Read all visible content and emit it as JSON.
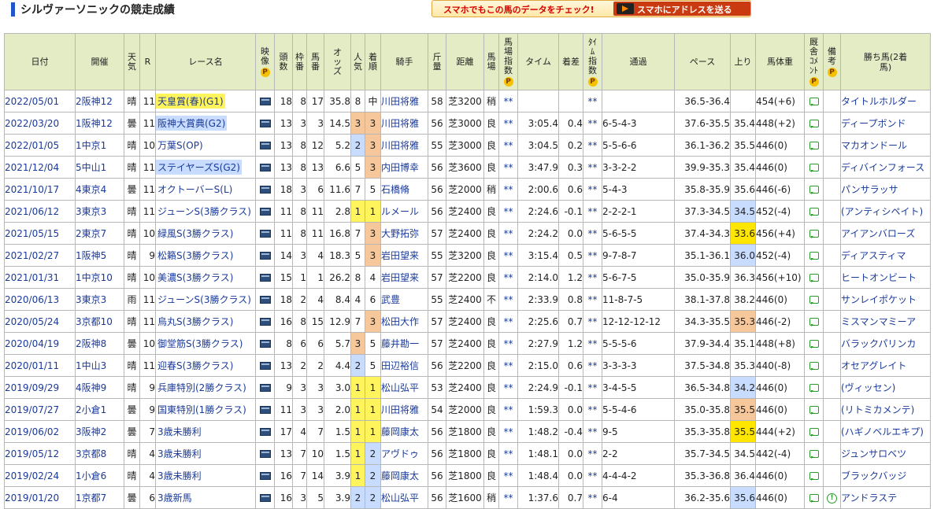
{
  "title": "シルヴァーソニックの競走成績",
  "banner": {
    "text": "スマホでもこの馬のデータをチェック!",
    "button_label": "スマホにアドレスを送る"
  },
  "headers": [
    "日付",
    "開催",
    "天気",
    "R",
    "レース名",
    "映像",
    "頭数",
    "枠番",
    "馬番",
    "オッズ",
    "人気",
    "着順",
    "騎手",
    "斤量",
    "距離",
    "馬場",
    "馬場指数",
    "タイム",
    "着差",
    "ﾀｲﾑ指数",
    "通過",
    "ペース",
    "上り",
    "馬体重",
    "厩舎ｺﾒﾝﾄ",
    "備考",
    "勝ち馬(2着馬)"
  ],
  "colors": {
    "header_bg": "#e4ecc6",
    "link": "#1a3a9a",
    "rank1": "#fff45c",
    "rank2": "#c8dcff",
    "rank3": "#f6c79a",
    "premium_badge": "#f5c000"
  },
  "rows": [
    {
      "date": "2022/05/01",
      "venue": "2阪神12",
      "weather": "晴",
      "r": "11",
      "race": "天皇賞(春)(G1)",
      "race_hl": "yellow",
      "heads": "18",
      "waku": "8",
      "umaban": "17",
      "odds": "35.8",
      "pop": "8",
      "pop_hl": "",
      "rank": "中",
      "rank_hl": "",
      "jockey": "川田将雅",
      "weight": "58",
      "dist": "芝3200",
      "baba": "稍",
      "baba_idx": "**",
      "time": "",
      "margin": "",
      "time_idx": "**",
      "pass": "",
      "pace": "36.5-36.4",
      "last3": "",
      "last3_hl": "",
      "body": "454(+6)",
      "note": false,
      "winner": "タイトルホルダー"
    },
    {
      "date": "2022/03/20",
      "venue": "1阪神12",
      "weather": "曇",
      "r": "11",
      "race": "阪神大賞典(G2)",
      "race_hl": "blue",
      "heads": "13",
      "waku": "3",
      "umaban": "3",
      "odds": "14.5",
      "pop": "3",
      "pop_hl": "3",
      "rank": "3",
      "rank_hl": "3",
      "jockey": "川田将雅",
      "weight": "56",
      "dist": "芝3000",
      "baba": "良",
      "baba_idx": "**",
      "time": "3:05.4",
      "margin": "0.4",
      "time_idx": "**",
      "pass": "6-5-4-3",
      "pace": "37.6-35.5",
      "last3": "35.4",
      "last3_hl": "",
      "body": "448(+2)",
      "note": false,
      "winner": "ディープボンド"
    },
    {
      "date": "2022/01/05",
      "venue": "1中京1",
      "weather": "晴",
      "r": "10",
      "race": "万葉S(OP)",
      "race_hl": "",
      "heads": "13",
      "waku": "8",
      "umaban": "12",
      "odds": "5.2",
      "pop": "2",
      "pop_hl": "2",
      "rank": "3",
      "rank_hl": "3",
      "jockey": "川田将雅",
      "weight": "55",
      "dist": "芝3000",
      "baba": "良",
      "baba_idx": "**",
      "time": "3:04.5",
      "margin": "0.2",
      "time_idx": "**",
      "pass": "5-5-6-6",
      "pace": "36.1-36.2",
      "last3": "35.5",
      "last3_hl": "",
      "body": "446(0)",
      "note": false,
      "winner": "マカオンドール"
    },
    {
      "date": "2021/12/04",
      "venue": "5中山1",
      "weather": "晴",
      "r": "11",
      "race": "ステイヤーズS(G2)",
      "race_hl": "blue",
      "heads": "13",
      "waku": "8",
      "umaban": "13",
      "odds": "6.6",
      "pop": "5",
      "pop_hl": "",
      "rank": "3",
      "rank_hl": "3",
      "jockey": "内田博幸",
      "weight": "56",
      "dist": "芝3600",
      "baba": "良",
      "baba_idx": "**",
      "time": "3:47.9",
      "margin": "0.3",
      "time_idx": "**",
      "pass": "3-3-2-2",
      "pace": "39.9-35.3",
      "last3": "35.4",
      "last3_hl": "",
      "body": "446(0)",
      "note": false,
      "winner": "ディバインフォース"
    },
    {
      "date": "2021/10/17",
      "venue": "4東京4",
      "weather": "曇",
      "r": "11",
      "race": "オクトーバーS(L)",
      "race_hl": "",
      "heads": "18",
      "waku": "3",
      "umaban": "6",
      "odds": "11.6",
      "pop": "7",
      "pop_hl": "",
      "rank": "5",
      "rank_hl": "",
      "jockey": "石橋脩",
      "weight": "56",
      "dist": "芝2000",
      "baba": "稍",
      "baba_idx": "**",
      "time": "2:00.6",
      "margin": "0.6",
      "time_idx": "**",
      "pass": "5-4-3",
      "pace": "35.8-35.9",
      "last3": "35.6",
      "last3_hl": "",
      "body": "446(-6)",
      "note": false,
      "winner": "パンサラッサ"
    },
    {
      "date": "2021/06/12",
      "venue": "3東京3",
      "weather": "晴",
      "r": "11",
      "race": "ジューンS(3勝クラス)",
      "race_hl": "",
      "heads": "11",
      "waku": "8",
      "umaban": "11",
      "odds": "2.8",
      "pop": "1",
      "pop_hl": "1",
      "rank": "1",
      "rank_hl": "1",
      "jockey": "ルメール",
      "weight": "56",
      "dist": "芝2400",
      "baba": "良",
      "baba_idx": "**",
      "time": "2:24.6",
      "margin": "-0.1",
      "time_idx": "**",
      "pass": "2-2-2-1",
      "pace": "37.3-34.5",
      "last3": "34.5",
      "last3_hl": "2",
      "body": "452(-4)",
      "note": false,
      "winner": "(アンティシペイト)"
    },
    {
      "date": "2021/05/15",
      "venue": "2東京7",
      "weather": "晴",
      "r": "10",
      "race": "緑風S(3勝クラス)",
      "race_hl": "",
      "heads": "11",
      "waku": "8",
      "umaban": "11",
      "odds": "16.8",
      "pop": "7",
      "pop_hl": "",
      "rank": "3",
      "rank_hl": "3",
      "jockey": "大野拓弥",
      "weight": "57",
      "dist": "芝2400",
      "baba": "良",
      "baba_idx": "**",
      "time": "2:24.2",
      "margin": "0.0",
      "time_idx": "**",
      "pass": "5-6-5-5",
      "pace": "37.4-34.3",
      "last3": "33.6",
      "last3_hl": "1",
      "body": "456(+4)",
      "note": false,
      "winner": "アイアンバローズ"
    },
    {
      "date": "2021/02/27",
      "venue": "1阪神5",
      "weather": "晴",
      "r": "9",
      "race": "松籟S(3勝クラス)",
      "race_hl": "",
      "heads": "14",
      "waku": "3",
      "umaban": "4",
      "odds": "18.3",
      "pop": "5",
      "pop_hl": "",
      "rank": "3",
      "rank_hl": "3",
      "jockey": "岩田望来",
      "weight": "55",
      "dist": "芝3200",
      "baba": "良",
      "baba_idx": "**",
      "time": "3:15.4",
      "margin": "0.5",
      "time_idx": "**",
      "pass": "9-7-8-7",
      "pace": "35.1-36.1",
      "last3": "36.0",
      "last3_hl": "2",
      "body": "452(-4)",
      "note": false,
      "winner": "ディアスティマ"
    },
    {
      "date": "2021/01/31",
      "venue": "1中京10",
      "weather": "晴",
      "r": "10",
      "race": "美濃S(3勝クラス)",
      "race_hl": "",
      "heads": "15",
      "waku": "1",
      "umaban": "1",
      "odds": "26.2",
      "pop": "8",
      "pop_hl": "",
      "rank": "4",
      "rank_hl": "",
      "jockey": "岩田望来",
      "weight": "57",
      "dist": "芝2200",
      "baba": "良",
      "baba_idx": "**",
      "time": "2:14.0",
      "margin": "1.2",
      "time_idx": "**",
      "pass": "5-6-7-5",
      "pace": "35.0-35.9",
      "last3": "36.3",
      "last3_hl": "",
      "body": "456(+10)",
      "note": false,
      "winner": "ヒートオンビート"
    },
    {
      "date": "2020/06/13",
      "venue": "3東京3",
      "weather": "雨",
      "r": "11",
      "race": "ジューンS(3勝クラス)",
      "race_hl": "",
      "heads": "18",
      "waku": "2",
      "umaban": "4",
      "odds": "8.4",
      "pop": "4",
      "pop_hl": "",
      "rank": "6",
      "rank_hl": "",
      "jockey": "武豊",
      "weight": "55",
      "dist": "芝2400",
      "baba": "不",
      "baba_idx": "**",
      "time": "2:33.9",
      "margin": "0.8",
      "time_idx": "**",
      "pass": "11-8-7-5",
      "pace": "38.1-37.8",
      "last3": "38.2",
      "last3_hl": "",
      "body": "446(0)",
      "note": false,
      "winner": "サンレイポケット"
    },
    {
      "date": "2020/05/24",
      "venue": "3京都10",
      "weather": "晴",
      "r": "11",
      "race": "烏丸S(3勝クラス)",
      "race_hl": "",
      "heads": "16",
      "waku": "8",
      "umaban": "15",
      "odds": "12.9",
      "pop": "7",
      "pop_hl": "",
      "rank": "3",
      "rank_hl": "3",
      "jockey": "松田大作",
      "weight": "57",
      "dist": "芝2400",
      "baba": "良",
      "baba_idx": "**",
      "time": "2:25.6",
      "margin": "0.7",
      "time_idx": "**",
      "pass": "12-12-12-12",
      "pace": "34.3-35.5",
      "last3": "35.3",
      "last3_hl": "3",
      "body": "446(-2)",
      "note": false,
      "winner": "ミスマンマミーア"
    },
    {
      "date": "2020/04/19",
      "venue": "2阪神8",
      "weather": "曇",
      "r": "10",
      "race": "御堂筋S(3勝クラス)",
      "race_hl": "",
      "heads": "8",
      "waku": "6",
      "umaban": "6",
      "odds": "5.7",
      "pop": "3",
      "pop_hl": "3",
      "rank": "5",
      "rank_hl": "",
      "jockey": "藤井勘一",
      "weight": "57",
      "dist": "芝2400",
      "baba": "良",
      "baba_idx": "**",
      "time": "2:27.9",
      "margin": "1.2",
      "time_idx": "**",
      "pass": "5-5-5-6",
      "pace": "37.9-34.4",
      "last3": "35.1",
      "last3_hl": "",
      "body": "448(+8)",
      "note": false,
      "winner": "バラックパリンカ"
    },
    {
      "date": "2020/01/11",
      "venue": "1中山3",
      "weather": "晴",
      "r": "11",
      "race": "迎春S(3勝クラス)",
      "race_hl": "",
      "heads": "13",
      "waku": "2",
      "umaban": "2",
      "odds": "4.4",
      "pop": "2",
      "pop_hl": "2",
      "rank": "5",
      "rank_hl": "",
      "jockey": "田辺裕信",
      "weight": "56",
      "dist": "芝2200",
      "baba": "良",
      "baba_idx": "**",
      "time": "2:15.0",
      "margin": "0.6",
      "time_idx": "**",
      "pass": "3-3-3-3",
      "pace": "37.5-34.8",
      "last3": "35.3",
      "last3_hl": "",
      "body": "440(-8)",
      "note": false,
      "winner": "オセアグレイト"
    },
    {
      "date": "2019/09/29",
      "venue": "4阪神9",
      "weather": "晴",
      "r": "9",
      "race": "兵庫特別(2勝クラス)",
      "race_hl": "",
      "heads": "9",
      "waku": "3",
      "umaban": "3",
      "odds": "3.0",
      "pop": "1",
      "pop_hl": "1",
      "rank": "1",
      "rank_hl": "1",
      "jockey": "松山弘平",
      "weight": "53",
      "dist": "芝2400",
      "baba": "良",
      "baba_idx": "**",
      "time": "2:24.9",
      "margin": "-0.1",
      "time_idx": "**",
      "pass": "3-4-5-5",
      "pace": "36.5-34.8",
      "last3": "34.2",
      "last3_hl": "2",
      "body": "446(0)",
      "note": false,
      "winner": "(ヴィッセン)"
    },
    {
      "date": "2019/07/27",
      "venue": "2小倉1",
      "weather": "曇",
      "r": "9",
      "race": "国東特別(1勝クラス)",
      "race_hl": "",
      "heads": "11",
      "waku": "3",
      "umaban": "3",
      "odds": "2.0",
      "pop": "1",
      "pop_hl": "1",
      "rank": "1",
      "rank_hl": "1",
      "jockey": "川田将雅",
      "weight": "54",
      "dist": "芝2000",
      "baba": "良",
      "baba_idx": "**",
      "time": "1:59.3",
      "margin": "0.0",
      "time_idx": "**",
      "pass": "5-5-4-6",
      "pace": "35.0-35.8",
      "last3": "35.5",
      "last3_hl": "3",
      "body": "446(0)",
      "note": false,
      "winner": "(リトミカメンテ)"
    },
    {
      "date": "2019/06/02",
      "venue": "3阪神2",
      "weather": "曇",
      "r": "7",
      "race": "3歳未勝利",
      "race_hl": "",
      "heads": "17",
      "waku": "4",
      "umaban": "7",
      "odds": "1.5",
      "pop": "1",
      "pop_hl": "1",
      "rank": "1",
      "rank_hl": "1",
      "jockey": "藤岡康太",
      "weight": "56",
      "dist": "芝1800",
      "baba": "良",
      "baba_idx": "**",
      "time": "1:48.2",
      "margin": "-0.4",
      "time_idx": "**",
      "pass": "9-5",
      "pace": "35.3-35.8",
      "last3": "35.5",
      "last3_hl": "1",
      "body": "444(+2)",
      "note": false,
      "winner": "(ハギノベルエキプ)"
    },
    {
      "date": "2019/05/12",
      "venue": "3京都8",
      "weather": "晴",
      "r": "4",
      "race": "3歳未勝利",
      "race_hl": "",
      "heads": "13",
      "waku": "7",
      "umaban": "10",
      "odds": "1.5",
      "pop": "1",
      "pop_hl": "1",
      "rank": "2",
      "rank_hl": "2",
      "jockey": "アヴドゥ",
      "weight": "56",
      "dist": "芝1800",
      "baba": "良",
      "baba_idx": "**",
      "time": "1:48.1",
      "margin": "0.0",
      "time_idx": "**",
      "pass": "2-2",
      "pace": "35.7-34.5",
      "last3": "34.5",
      "last3_hl": "",
      "body": "442(-4)",
      "note": false,
      "winner": "ジュンサロベツ"
    },
    {
      "date": "2019/02/24",
      "venue": "1小倉6",
      "weather": "晴",
      "r": "4",
      "race": "3歳未勝利",
      "race_hl": "",
      "heads": "16",
      "waku": "7",
      "umaban": "14",
      "odds": "3.9",
      "pop": "1",
      "pop_hl": "1",
      "rank": "2",
      "rank_hl": "2",
      "jockey": "藤岡康太",
      "weight": "56",
      "dist": "芝1800",
      "baba": "良",
      "baba_idx": "**",
      "time": "1:48.4",
      "margin": "0.0",
      "time_idx": "**",
      "pass": "4-4-4-2",
      "pace": "35.3-36.8",
      "last3": "36.4",
      "last3_hl": "",
      "body": "446(0)",
      "note": false,
      "winner": "ブラックバッジ"
    },
    {
      "date": "2019/01/20",
      "venue": "1京都7",
      "weather": "曇",
      "r": "6",
      "race": "3歳新馬",
      "race_hl": "",
      "heads": "16",
      "waku": "3",
      "umaban": "5",
      "odds": "3.9",
      "pop": "2",
      "pop_hl": "2",
      "rank": "2",
      "rank_hl": "2",
      "jockey": "松山弘平",
      "weight": "56",
      "dist": "芝1600",
      "baba": "稍",
      "baba_idx": "**",
      "time": "1:37.6",
      "margin": "0.7",
      "time_idx": "**",
      "pass": "6-4",
      "pace": "36.2-35.6",
      "last3": "35.6",
      "last3_hl": "2",
      "body": "446(0)",
      "note": true,
      "winner": "アンドラステ"
    }
  ]
}
